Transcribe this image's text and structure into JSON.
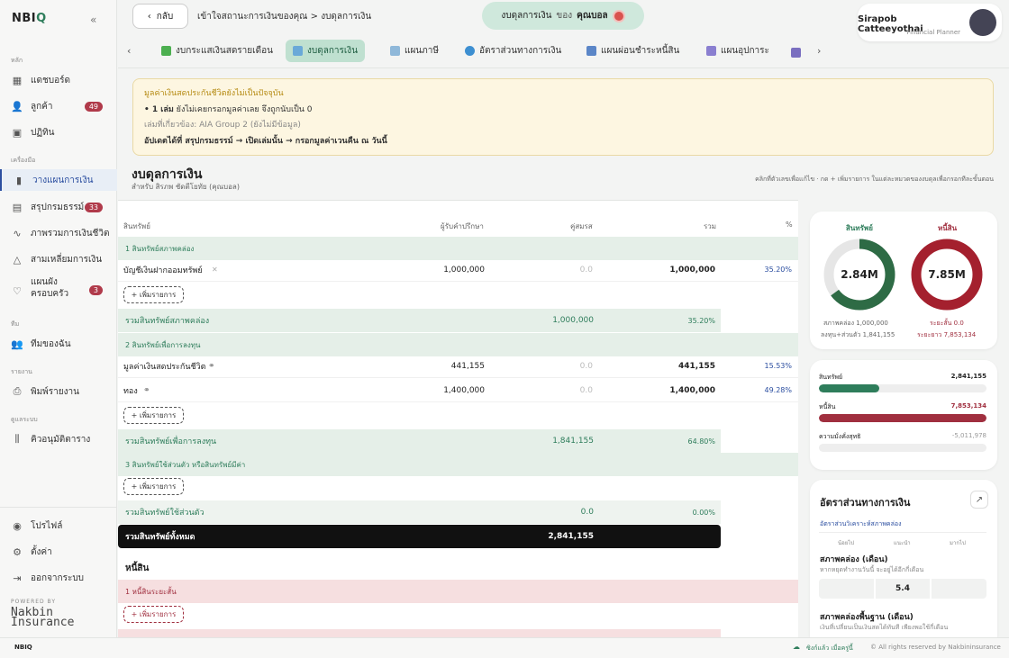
{
  "app": {
    "logo_a": "NBI",
    "logo_b": "Q",
    "collapse": "«"
  },
  "sidebar": {
    "sections": {
      "main": "หลัก",
      "tools": "เครื่องมือ",
      "team": "ทีม",
      "report": "รายงาน",
      "admin": "ดูแลระบบ"
    },
    "items": [
      {
        "label": "แดชบอร์ด",
        "icon": "▦"
      },
      {
        "label": "ลูกค้า",
        "icon": "👤",
        "badge": "49"
      },
      {
        "label": "ปฏิทิน",
        "icon": "▣"
      },
      {
        "label": "วางแผนการเงิน",
        "icon": "▮"
      },
      {
        "label": "สรุปกรมธรรม์",
        "icon": "▤",
        "badge": "33"
      },
      {
        "label": "ภาพรวมการเงินชีวิต",
        "icon": "∿"
      },
      {
        "label": "สามเหลี่ยมการเงิน",
        "icon": "△"
      },
      {
        "label": "แผนผัง",
        "label2": "ครอบครัว",
        "icon": "♡",
        "badge": "3"
      },
      {
        "label": "ทีมของฉัน",
        "icon": "👥"
      },
      {
        "label": "พิมพ์รายงาน",
        "icon": "⎙"
      },
      {
        "label": "คิวอนุมัติตาราง",
        "icon": "⫼"
      },
      {
        "label": "โปรไฟล์",
        "icon": "◉"
      },
      {
        "label": "ตั้งค่า",
        "icon": "⚙"
      },
      {
        "label": "ออกจากระบบ",
        "icon": "⇥"
      }
    ],
    "powered": "POWERED BY",
    "brand_a": "Nakbin",
    "brand_b": "Insurance"
  },
  "topbar": {
    "back": "กลับ",
    "breadcrumb": "เข้าใจสถานะการเงินของคุณ > งบดุลการเงิน",
    "pill_a": "งบดุลการเงิน",
    "pill_b": "ของ",
    "pill_c": "คุณบอล"
  },
  "user": {
    "name": "Sirapob Catteeyothai",
    "role": "Financial Planner"
  },
  "tabs": [
    {
      "label": "งบกระแสเงินสดรายเดือน",
      "color": "#4caf50"
    },
    {
      "label": "งบดุลการเงิน",
      "color": "#6aa9d8"
    },
    {
      "label": "แผนภาษี",
      "color": "#8fb8d9"
    },
    {
      "label": "อัตราส่วนทางการเงิน",
      "color": "#3d8fd1"
    },
    {
      "label": "แผนผ่อนชำระหนี้สิน",
      "color": "#5b86c7"
    },
    {
      "label": "แผนอุปการะ",
      "color": "#8a7fd0"
    }
  ],
  "alert": {
    "title": "มูลค่าเงินสดประกันชีวิตยังไม่เป็นปัจจุบัน",
    "line1a": "• 1 เล่ม",
    "line1b": " ยังไม่เคยกรอกมูลค่าเลย จึงถูกนับเป็น 0",
    "line2": "เล่มที่เกี่ยวข้อง: AIA Group 2 (ยังไม่มีข้อมูล)",
    "line3": "อัปเดตได้ที่ สรุปกรมธรรม์ → เปิดเล่มนั้น → กรอกมูลค่าเวนคืน ณ วันนี้"
  },
  "balance": {
    "title": "งบดุลการเงิน",
    "subtitle": "สำหรับ สิรภพ ชัดตีโยทัย (คุณบอล)",
    "hint": "คลิกที่ตัวเลขเพื่อแก้ไข · กด + เพิ่มรายการ ในแต่ละหมวดของงบดุลเพื่อกรอกทีละขั้นตอน"
  },
  "table": {
    "headers": {
      "asset": "สินทรัพย์",
      "client": "ผู้รับคำปรึกษา",
      "spouse": "คู่สมรส",
      "sum": "รวม",
      "pct": "%"
    },
    "add": "+ เพิ่มรายการ",
    "cat1": "1 สินทรัพย์สภาพคล่อง",
    "r1": {
      "name": "บัญชีเงินฝากออมทรัพย์",
      "client": "1,000,000",
      "spouse": "0.0",
      "sum": "1,000,000",
      "pct": "35.20%"
    },
    "sub1": {
      "name": "รวมสินทรัพย์สภาพคล่อง",
      "sum": "1,000,000",
      "pct": "35.20%"
    },
    "cat2": "2 สินทรัพย์เพื่อการลงทุน",
    "r2": {
      "name": "มูลค่าเงินสดประกันชีวิต",
      "client": "441,155",
      "spouse": "0.0",
      "sum": "441,155",
      "pct": "15.53%"
    },
    "r3": {
      "name": "ทอง",
      "client": "1,400,000",
      "spouse": "0.0",
      "sum": "1,400,000",
      "pct": "49.28%"
    },
    "sub2": {
      "name": "รวมสินทรัพย์เพื่อการลงทุน",
      "sum": "1,841,155",
      "pct": "64.80%"
    },
    "cat3": "3 สินทรัพย์ใช้ส่วนตัว หรือสินทรัพย์มีค่า",
    "sub3": {
      "name": "รวมสินทรัพย์ใช้ส่วนตัว",
      "sum": "0.0",
      "pct": "0.00%"
    },
    "total": {
      "name": "รวมสินทรัพย์ทั้งหมด",
      "sum": "2,841,155"
    },
    "liab": "หนี้สิน",
    "lcat1": "1 หนี้สินระยะสั้น"
  },
  "summary": {
    "asset_label": "สินทรัพย์",
    "liab_label": "หนี้สิน",
    "asset_value": "2.84M",
    "liab_value": "7.85M",
    "asset_liquid": "สภาพคล่อง 1,000,000",
    "asset_invest": "ลงทุน+ส่วนตัว 1,841,155",
    "liab_short": "ระยะสั้น 0.0",
    "liab_long": "ระยะยาว 7,853,134",
    "asset_liquid_share": 0.352,
    "bars": [
      {
        "label": "สินทรัพย์",
        "value": "2,841,155",
        "fill": 0.362,
        "color": "#2e7d5b"
      },
      {
        "label": "หนี้สิน",
        "value": "7,853,134",
        "fill": 1.0,
        "color": "#a02f3f"
      },
      {
        "label": "ความมั่งคั่งสุทธิ",
        "value": "-5,011,978",
        "fill": 0,
        "color": "#999"
      }
    ]
  },
  "ratios": {
    "title": "อัตราส่วนทางการเงิน",
    "subtitle": "อัตราส่วนวิเคราะห์สภาพคล่อง",
    "cols": [
      "น้อยไป",
      "แนะนำ",
      "มากไป"
    ],
    "r1_title": "สภาพคล่อง (เดือน)",
    "r1_desc": "หากหยุดทำงานวันนี้ จะอยู่ได้อีกกี่เดือน",
    "r1_value": "5.4",
    "r2_title": "สภาพคล่องพื้นฐาน (เดือน)",
    "r2_desc": "เงินที่เปลี่ยนเป็นเงินสดได้ทันที เพียงพอใช้กี่เดือน"
  },
  "footer": {
    "brand": "NBIQ",
    "sync": "ซิงก์แล้ว เมื่อครู่นี้",
    "rights": "© All rights reserved by Nakbininsurance"
  }
}
